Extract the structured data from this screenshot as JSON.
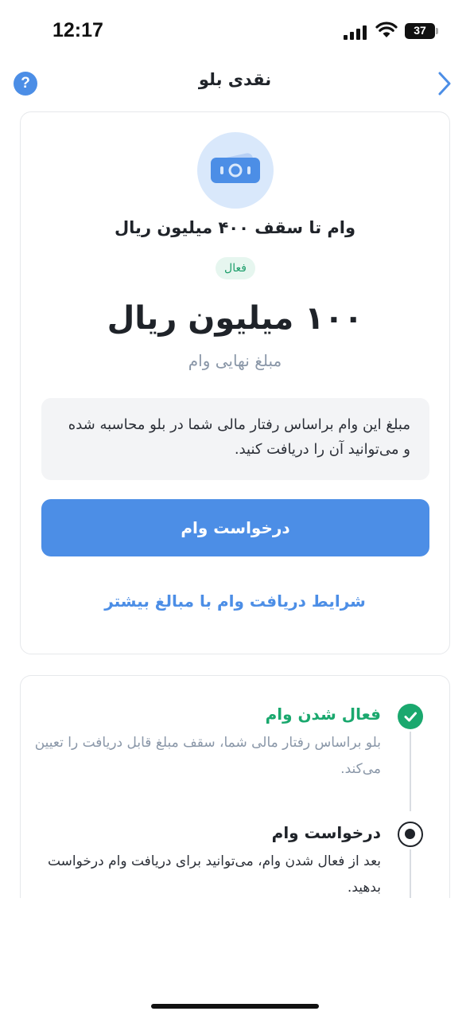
{
  "status_bar": {
    "time": "12:17",
    "battery": "37"
  },
  "header": {
    "title": "نقدی بلو",
    "help_glyph": "?"
  },
  "loan_card": {
    "icon": "banknote-icon",
    "title": "وام تا سقف ۴۰۰ میلیون ریال",
    "status_badge": "فعال",
    "amount": "۱۰۰ میلیون ریال",
    "amount_caption": "مبلغ نهایی وام",
    "info_text": "مبلغ این وام براساس رفتار مالی شما در بلو محاسبه شده و می‌توانید آن را دریافت کنید.",
    "request_button": "درخواست وام",
    "conditions_link": "شرایط دریافت وام با مبالغ بیشتر"
  },
  "steps": [
    {
      "title": "فعال شدن وام",
      "description": "بلو براساس رفتار مالی شما، سقف مبلغ قابل دریافت را تعیین می‌کند.",
      "state": "done"
    },
    {
      "title": "درخواست وام",
      "description": "بعد از فعال شدن وام، می‌توانید برای دریافت وام درخواست بدهید.",
      "state": "current"
    }
  ],
  "colors": {
    "accent": "#4c8ee6",
    "success": "#1aa86e",
    "muted": "#8a97a8"
  }
}
